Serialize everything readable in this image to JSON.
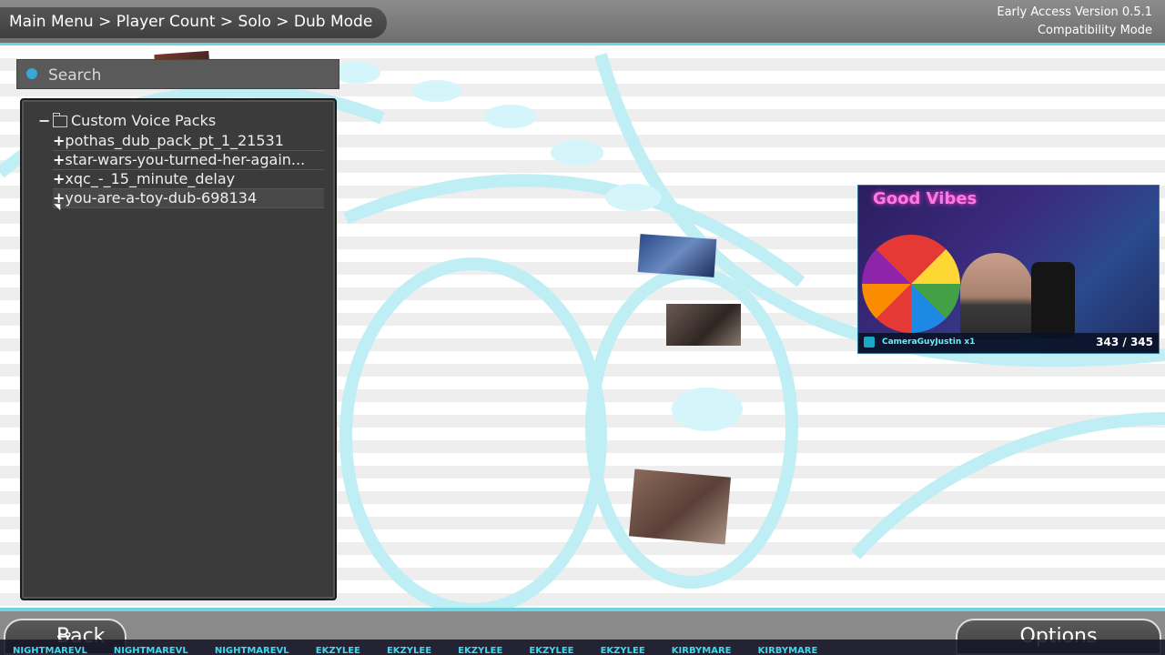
{
  "header": {
    "breadcrumb": "Main Menu > Player Count > Solo > Dub Mode",
    "version": "Early Access Version 0.5.1",
    "mode": "Compatibility Mode"
  },
  "search": {
    "placeholder": "Search",
    "value": ""
  },
  "tree": {
    "root_symbol": "−",
    "root_label": "Custom Voice Packs",
    "items": [
      {
        "label": "pothas_dub_pack_pt_1_21531"
      },
      {
        "label": "star-wars-you-turned-her-again..."
      },
      {
        "label": "xqc_-_15_minute_delay"
      },
      {
        "label": "you-are-a-toy-dub-698134"
      }
    ],
    "item_symbol": "+"
  },
  "webcam": {
    "sign": "Good Vibes",
    "event": "CameraGuyJustin x1",
    "count": "343 / 345"
  },
  "footer": {
    "back_label": "Back",
    "back_icon": "↩",
    "options_label": "Options",
    "ticker": [
      "NIGHTMAREVL",
      "NIGHTMAREVL",
      "NIGHTMAREVL",
      "EKZYLEE",
      "EKZYLEE",
      "EKZYLEE",
      "EKZYLEE",
      "EKZYLEE",
      "KIRBYMARE",
      "KIRBYMARE"
    ]
  },
  "colors": {
    "accent": "#6fd3e0",
    "panel": "#3b3b3b"
  }
}
